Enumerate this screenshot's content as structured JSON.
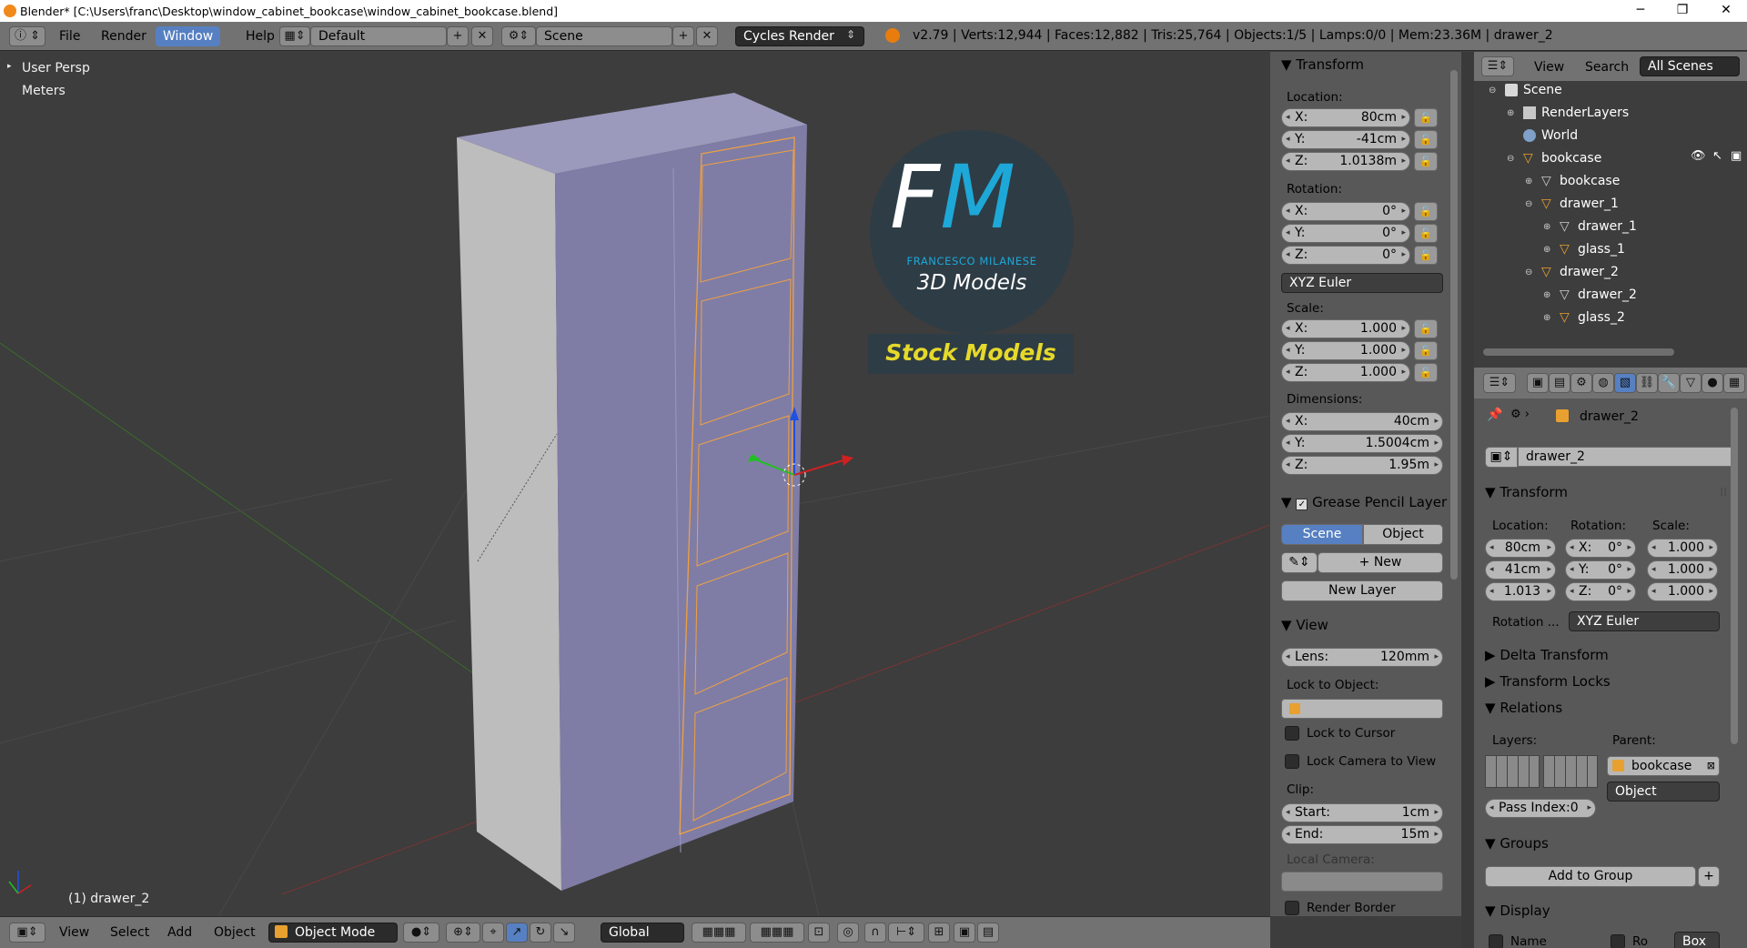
{
  "window": {
    "title": "Blender* [C:\\Users\\franc\\Desktop\\window_cabinet_bookcase\\window_cabinet_bookcase.blend]",
    "controls": [
      "─",
      "❐",
      "✕"
    ]
  },
  "header": {
    "menus": [
      "File",
      "Render",
      "Window",
      "Help"
    ],
    "active_menu": "Window",
    "screen_layout": "Default",
    "scene": "Scene",
    "engine": "Cycles Render",
    "stats": "v2.79 | Verts:12,944 | Faces:12,882 | Tris:25,764 | Objects:1/5 | Lamps:0/0 | Mem:23.36M | drawer_2"
  },
  "viewport": {
    "view_name": "User Persp",
    "units": "Meters",
    "selected_label": "(1) drawer_2",
    "logo": {
      "letters_f": "F",
      "letters_m": "M",
      "brand": "FRANCESCO MILANESE",
      "sub": "3D Models",
      "banner": "Stock Models"
    }
  },
  "bottom_header": {
    "menus": [
      "View",
      "Select",
      "Add",
      "Object"
    ],
    "mode": "Object Mode",
    "orientation": "Global"
  },
  "npanel": {
    "transform": {
      "title": "Transform",
      "location_label": "Location:",
      "location": [
        {
          "axis": "X:",
          "value": "80cm"
        },
        {
          "axis": "Y:",
          "value": "-41cm"
        },
        {
          "axis": "Z:",
          "value": "1.0138m"
        }
      ],
      "rotation_label": "Rotation:",
      "rotation": [
        {
          "axis": "X:",
          "value": "0°"
        },
        {
          "axis": "Y:",
          "value": "0°"
        },
        {
          "axis": "Z:",
          "value": "0°"
        }
      ],
      "rotation_mode": "XYZ Euler",
      "scale_label": "Scale:",
      "scale": [
        {
          "axis": "X:",
          "value": "1.000"
        },
        {
          "axis": "Y:",
          "value": "1.000"
        },
        {
          "axis": "Z:",
          "value": "1.000"
        }
      ],
      "dimensions_label": "Dimensions:",
      "dimensions": [
        {
          "axis": "X:",
          "value": "40cm"
        },
        {
          "axis": "Y:",
          "value": "1.5004cm"
        },
        {
          "axis": "Z:",
          "value": "1.95m"
        }
      ]
    },
    "grease": {
      "title": "Grease Pencil Layer",
      "tab_scene": "Scene",
      "tab_object": "Object",
      "new": "New",
      "new_layer": "New Layer"
    },
    "view": {
      "title": "View",
      "lens_label": "Lens:",
      "lens": "120mm",
      "lock_label": "Lock to Object:",
      "lock_cursor": "Lock to Cursor",
      "lock_camera": "Lock Camera to View",
      "clip_label": "Clip:",
      "start_label": "Start:",
      "start": "1cm",
      "end_label": "End:",
      "end": "15m",
      "local_camera": "Local Camera:",
      "render_border": "Render Border"
    }
  },
  "outliner": {
    "header": {
      "view": "View",
      "search": "Search",
      "filter": "All Scenes"
    },
    "rows": [
      {
        "label": "Scene",
        "indent": 0
      },
      {
        "label": "RenderLayers",
        "indent": 1
      },
      {
        "label": "World",
        "indent": 1
      },
      {
        "label": "bookcase",
        "indent": 1
      },
      {
        "label": "bookcase",
        "indent": 2
      },
      {
        "label": "drawer_1",
        "indent": 2
      },
      {
        "label": "drawer_1",
        "indent": 3
      },
      {
        "label": "glass_1",
        "indent": 3
      },
      {
        "label": "drawer_2",
        "indent": 2
      },
      {
        "label": "drawer_2",
        "indent": 3
      },
      {
        "label": "glass_2",
        "indent": 3
      }
    ]
  },
  "properties": {
    "breadcrumb": "drawer_2",
    "object_name": "drawer_2",
    "transform": {
      "title": "Transform",
      "location_label": "Location:",
      "rotation_label": "Rotation:",
      "scale_label": "Scale:",
      "location": [
        "80cm",
        "41cm",
        "1.013"
      ],
      "rotation": [
        {
          "axis": "X:",
          "value": "0°"
        },
        {
          "axis": "Y:",
          "value": "0°"
        },
        {
          "axis": "Z:",
          "value": "0°"
        }
      ],
      "scale": [
        "1.000",
        "1.000",
        "1.000"
      ],
      "rotation_mode_label": "Rotation ...",
      "rotation_mode": "XYZ Euler"
    },
    "delta": "Delta Transform",
    "locks": "Transform Locks",
    "relations": {
      "title": "Relations",
      "layers_label": "Layers:",
      "parent_label": "Parent:",
      "parent": "bookcase",
      "parent_type": "Object",
      "pass_index": "Pass Index:0"
    },
    "groups": {
      "title": "Groups",
      "add": "Add to Group"
    },
    "display": {
      "title": "Display",
      "name": "Name",
      "ro": "Ro",
      "box": "Box"
    }
  },
  "colors": {
    "accent_blue": "#5680c2",
    "selection_orange": "#f0a040",
    "logo_cyan": "#1da8d8",
    "banner_yellow": "#e5d92a"
  }
}
